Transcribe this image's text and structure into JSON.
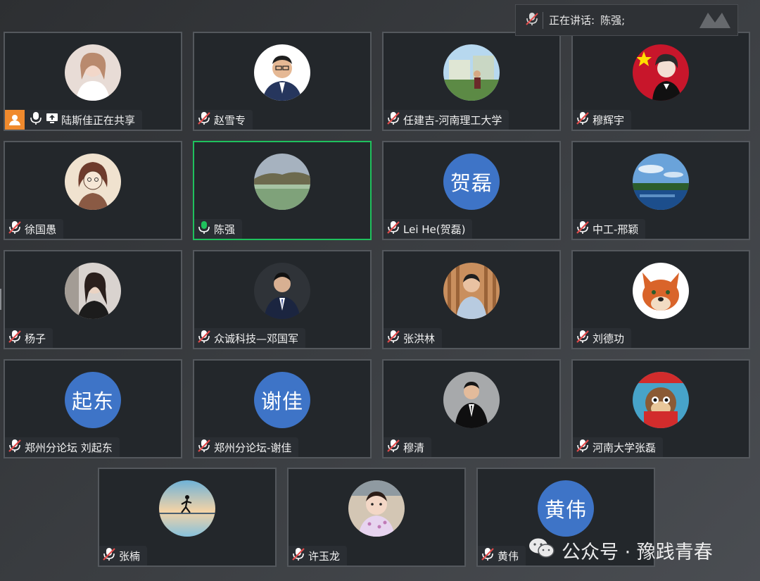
{
  "speaking_indicator": {
    "label": "正在讲话:",
    "speaker": "陈强;"
  },
  "participants": [
    {
      "name": "陆斯佳正在共享",
      "avatar": "photo-woman-light",
      "mic": "on",
      "sharing": true
    },
    {
      "name": "赵雪专",
      "avatar": "photo-man-suit",
      "mic": "muted"
    },
    {
      "name": "任建吉-河南理工大学",
      "avatar": "photo-outdoor-building",
      "mic": "muted"
    },
    {
      "name": "穆辉宇",
      "avatar": "photo-anime-flag",
      "mic": "muted"
    },
    {
      "name": "徐国愚",
      "avatar": "photo-sketch-portrait",
      "mic": "muted"
    },
    {
      "name": "陈强",
      "avatar": "photo-lake-landscape",
      "mic": "active",
      "speaking": true
    },
    {
      "name": "Lei He(贺磊)",
      "avatar_text": "贺磊",
      "mic": "muted"
    },
    {
      "name": "中工-邢颖",
      "avatar": "photo-river-sky",
      "mic": "muted"
    },
    {
      "name": "杨子",
      "avatar": "photo-woman-dark",
      "mic": "muted"
    },
    {
      "name": "众诚科技—邓国军",
      "avatar": "photo-man-suit-dark",
      "mic": "muted"
    },
    {
      "name": "张洪林",
      "avatar": "photo-man-wood-bg",
      "mic": "muted"
    },
    {
      "name": "刘德功",
      "avatar": "photo-cartoon-fox",
      "mic": "muted"
    },
    {
      "name": "郑州分论坛 刘起东",
      "avatar_text": "起东",
      "mic": "muted"
    },
    {
      "name": "郑州分论坛-谢佳",
      "avatar_text": "谢佳",
      "mic": "muted"
    },
    {
      "name": "穆清",
      "avatar": "photo-man-black-suit",
      "mic": "muted"
    },
    {
      "name": "河南大学张磊",
      "avatar": "photo-cartoon-chipmunk",
      "mic": "muted"
    },
    {
      "name": "张楠",
      "avatar": "photo-runner-sunset",
      "mic": "muted"
    },
    {
      "name": "许玉龙",
      "avatar": "photo-baby",
      "mic": "muted"
    },
    {
      "name": "黄伟",
      "avatar_text": "黄伟",
      "mic": "muted"
    }
  ],
  "watermark": {
    "text": "公众号 · 豫践青春",
    "icon": "wechat-icon"
  },
  "colors": {
    "speaking_border": "#1fc15d",
    "text_avatar": "#3e74c7",
    "share_badge": "#f08a2d",
    "muted_icon": "#e24b4b"
  }
}
